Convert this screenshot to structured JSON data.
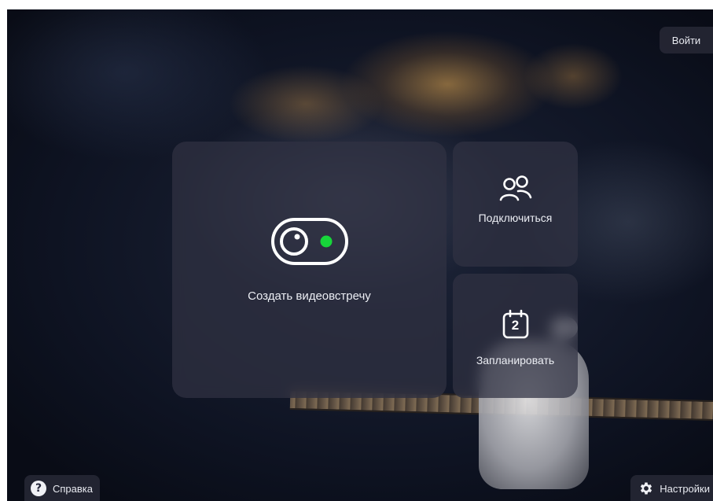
{
  "header": {
    "login_label": "Войти"
  },
  "actions": {
    "create_meeting_label": "Создать видеовстречу",
    "join_label": "Подключиться",
    "schedule_label": "Запланировать",
    "calendar_day": "2"
  },
  "footer": {
    "help_label": "Справка",
    "settings_label": "Настройки"
  },
  "icons": {
    "create": "camera-toggle-icon",
    "join": "people-icon",
    "schedule": "calendar-icon",
    "help": "question-circle-icon",
    "settings": "gear-icon"
  },
  "colors": {
    "accent_green": "#17d63a",
    "card_bg": "#303242",
    "text": "#eceef4"
  }
}
